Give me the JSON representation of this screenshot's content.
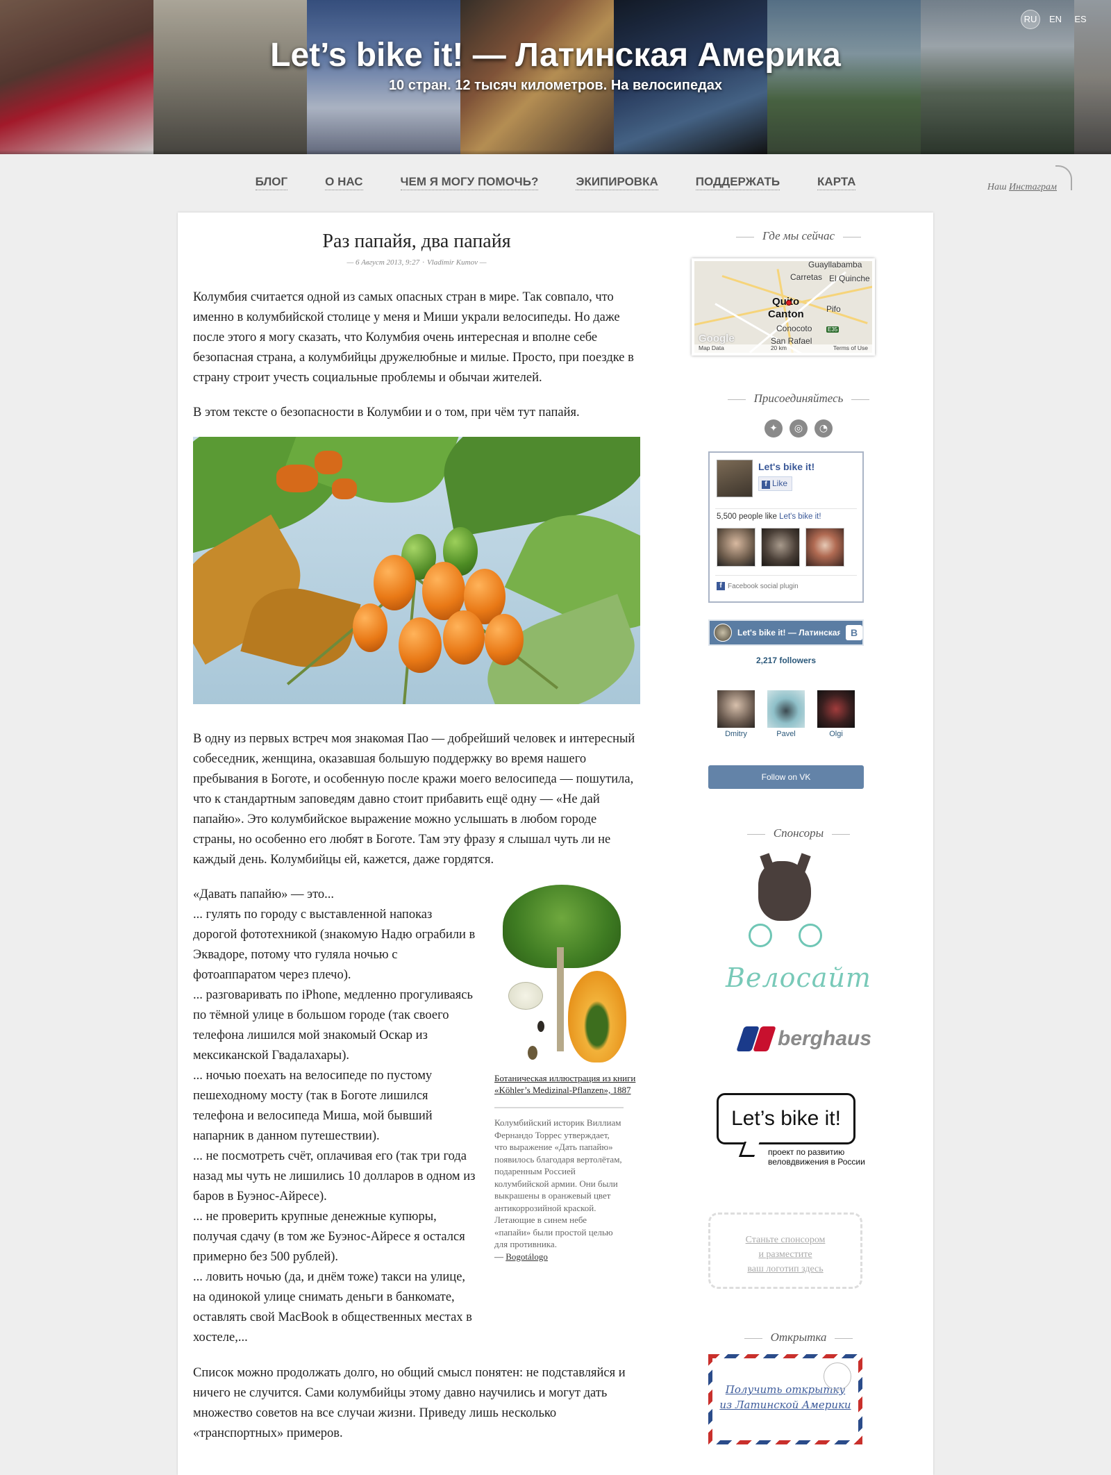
{
  "header": {
    "title": "Let’s bike it! — Латинская Америка",
    "tagline": "10 стран. 12 тысяч километров. На велосипедах",
    "languages": [
      {
        "code": "RU",
        "active": true
      },
      {
        "code": "EN",
        "active": false
      },
      {
        "code": "ES",
        "active": false
      }
    ]
  },
  "nav": {
    "items": [
      "БЛОГ",
      "О НАС",
      "ЧЕМ Я МОГУ ПОМОЧЬ?",
      "ЭКИПИРОВКА",
      "ПОДДЕРЖАТЬ",
      "КАРТА"
    ],
    "instagram_prefix": "Наш ",
    "instagram_link": "Инстаграм"
  },
  "article": {
    "title": "Раз папайя, два папайя",
    "meta_date": "— 6 Август 2013, 9:27",
    "meta_sep": "·",
    "meta_author": "Vladimir Kumov —",
    "p1": "Колумбия считается одной из самых опасных стран в мире. Так совпало, что именно в колумбийской столице у меня и Миши украли велосипеды. Но даже после этого я могу сказать, что Колумбия очень интересная и вполне себе безопасная страна, а колумбийцы дружелюбные и милые. Просто, при поездке в страну строит учесть социальные проблемы и обычаи жителей.",
    "p2": "В этом тексте о безопасности в Колумбии и о том, при чём тут папайя.",
    "p3": "В одну из первых встреч моя знакомая Пао — добрейший человек и интересный собеседник, женщина, оказавшая большую поддержку во время нашего пребывания в Боготе, и особенную после кражи моего велосипеда — пошутила, что к стандартным заповедям давно стоит прибавить ещё одну — «Не дай папайю». Это колумбийское выражение можно услышать в любом городе страны, но особенно его любят в Боготе. Там эту фразу я слышал чуть ли не каждый день. Колумбийцы ей, кажется, даже гордятся.",
    "list": [
      "«Давать папайю» — это...",
      "... гулять по городу с выставленной напоказ дорогой фототехникой (знакомую Надю ограбили в Эквадоре, потому что гуляла ночью с фотоаппаратом через плечо).",
      "... разговаривать по iPhone, медленно прогуливаясь по тёмной улице в большом городе (так своего телефона лишился мой знакомый Оскар из мексиканской Гвадалахары).",
      "... ночью поехать на велосипеде по пустому пешеходному мосту (так в Боготе лишился телефона и велосипеда Миша, мой бывший напарник в данном путешествии).",
      "... не посмотреть счёт, оплачивая его (так три года назад мы чуть не лишились 10 долларов в одном из баров в Буэнос-Айресе).",
      "... не проверить крупные денежные купюры, получая сдачу (в том же Буэнос-Айресе я остался примерно без 500 рублей).",
      "... ловить ночью (да, и днём тоже) такси на улице, на одинокой улице снимать деньги в банкомате, оставлять свой MacBook в общественных местах в хостеле,..."
    ],
    "aside_caption": "Ботаническая иллюстрация из книги «Köhler’s Medizinal-Pflanzen», 1887",
    "aside_text": "Колумбийский историк Виллиам Фернандо Торрес утверждает, что выражение «Дать папайю» появилось благодаря вертолётам, подаренным Россией колумбийской армии. Они были выкрашены в оранжевый цвет антикоррозийной краской. Летающие в синем небе «папайи» были простой целью для противника.",
    "aside_source_prefix": "— ",
    "aside_source": "Bogotálogo",
    "p4": "Список можно продолжать долго, но общий смысл понятен: не подставляйся и ничего не случится. Сами колумбийцы этому давно научились и могут дать множество советов на все случаи жизни. Приведу лишь несколько «транспортных» примеров."
  },
  "sidebar": {
    "where_title": "Где мы сейчас",
    "map": {
      "labels": [
        "Guayllabamba",
        "Carretas",
        "El Quinche",
        "Quito",
        "Canton",
        "Pifo",
        "Conocoto",
        "San Rafael"
      ],
      "highway": "E35",
      "google": "Google",
      "map_data": "Map Data",
      "scale": "20 km",
      "terms": "Terms of Use"
    },
    "join_title": "Присоединяйтесь",
    "social_icons": [
      "twitter-icon",
      "instagram-icon",
      "rss-icon"
    ],
    "facebook": {
      "page_name": "Let's bike it!",
      "like_label": "Like",
      "count_text": "5,500 people like ",
      "count_link": "Let's bike it!",
      "plugin_text": "Facebook social plugin"
    },
    "vk": {
      "group_name": "Let's bike it! — Латинская Америка",
      "logo": "B",
      "followers": "2,217 followers",
      "members": [
        "Dmitry",
        "Pavel",
        "Olgi"
      ],
      "follow_label": "Follow on VK"
    },
    "sponsors_title": "Спонсоры",
    "velosite": "Велосайт",
    "berghaus": "berghaus",
    "lbi_logo": "Let’s bike it!",
    "lbi_subtitle": "проект по развитию веловдвижения в России",
    "become_sponsor": [
      "Станьте спонсором",
      "и разместите",
      "ваш логотип здесь"
    ],
    "postcard_title": "Открытка",
    "postcard_link": [
      "Получить открытку",
      "из Латинской Америки"
    ]
  }
}
